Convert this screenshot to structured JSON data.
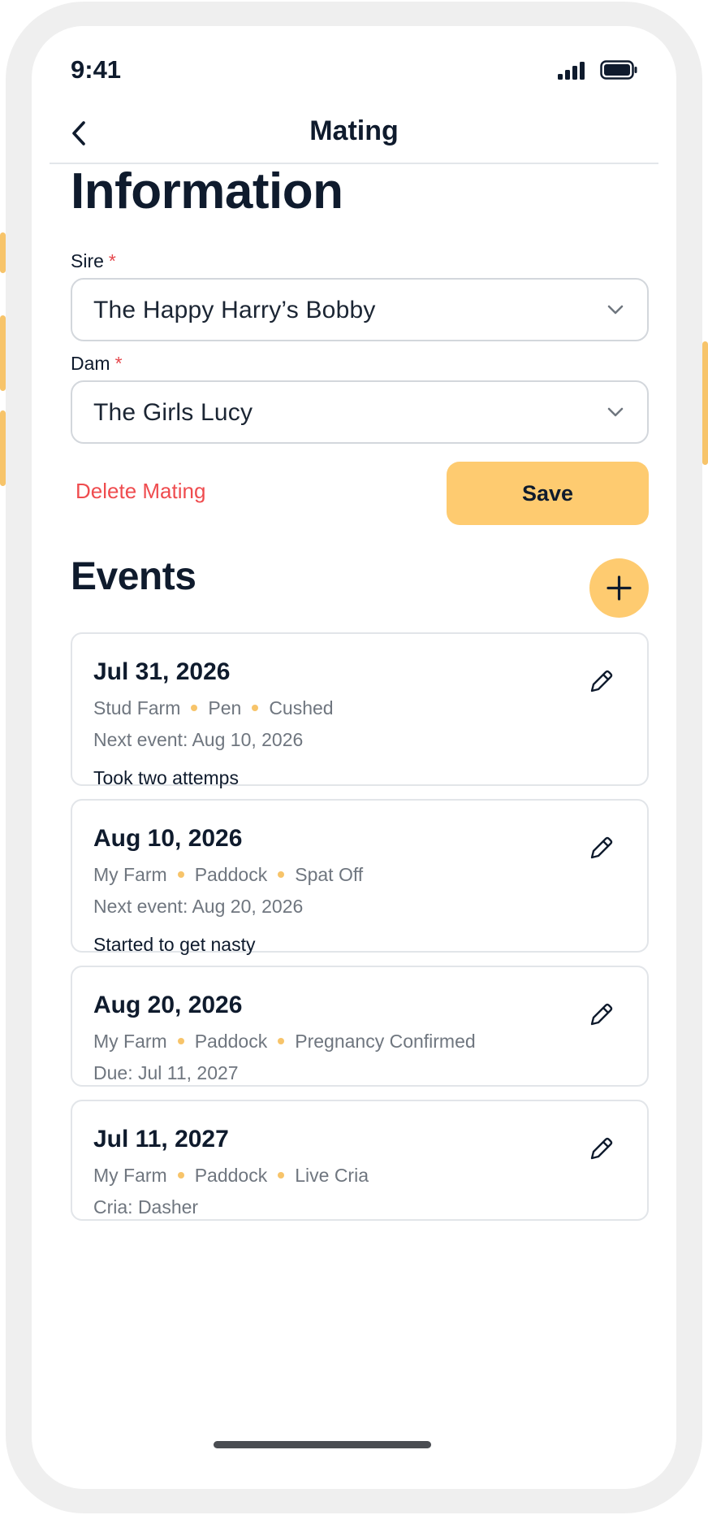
{
  "status_bar": {
    "time": "9:41"
  },
  "header": {
    "title": "Mating"
  },
  "information": {
    "heading": "Information",
    "sire": {
      "label": "Sire",
      "required_mark": "*",
      "value": "The Happy Harry’s Bobby"
    },
    "dam": {
      "label": "Dam",
      "required_mark": "*",
      "value": "The Girls Lucy"
    },
    "delete_label": "Delete Mating",
    "save_label": "Save"
  },
  "events": {
    "heading": "Events",
    "items": [
      {
        "date": "Jul 31, 2026",
        "location": "Stud Farm",
        "area": "Pen",
        "status": "Cushed",
        "line2": "Next event: Aug 10, 2026",
        "note": "Took two attemps"
      },
      {
        "date": "Aug 10, 2026",
        "location": "My Farm",
        "area": "Paddock",
        "status": "Spat Off",
        "line2": "Next event: Aug 20, 2026",
        "note": "Started to get nasty"
      },
      {
        "date": "Aug 20, 2026",
        "location": "My Farm",
        "area": "Paddock",
        "status": "Pregnancy Confirmed",
        "line2": "Due: Jul 11, 2027"
      },
      {
        "date": "Jul 11, 2027",
        "location": "My Farm",
        "area": "Paddock",
        "status": "Live Cria",
        "line2": "Cria: Dasher"
      }
    ]
  },
  "colors": {
    "accent": "#fecb70",
    "danger": "#ef4c4f",
    "text": "#0f1b2d",
    "muted": "#6f767f",
    "dot": "#f7c46a"
  },
  "icons": [
    "signal-icon",
    "battery-icon",
    "back-arrow-icon",
    "chevron-down-icon",
    "plus-icon",
    "pencil-icon"
  ]
}
